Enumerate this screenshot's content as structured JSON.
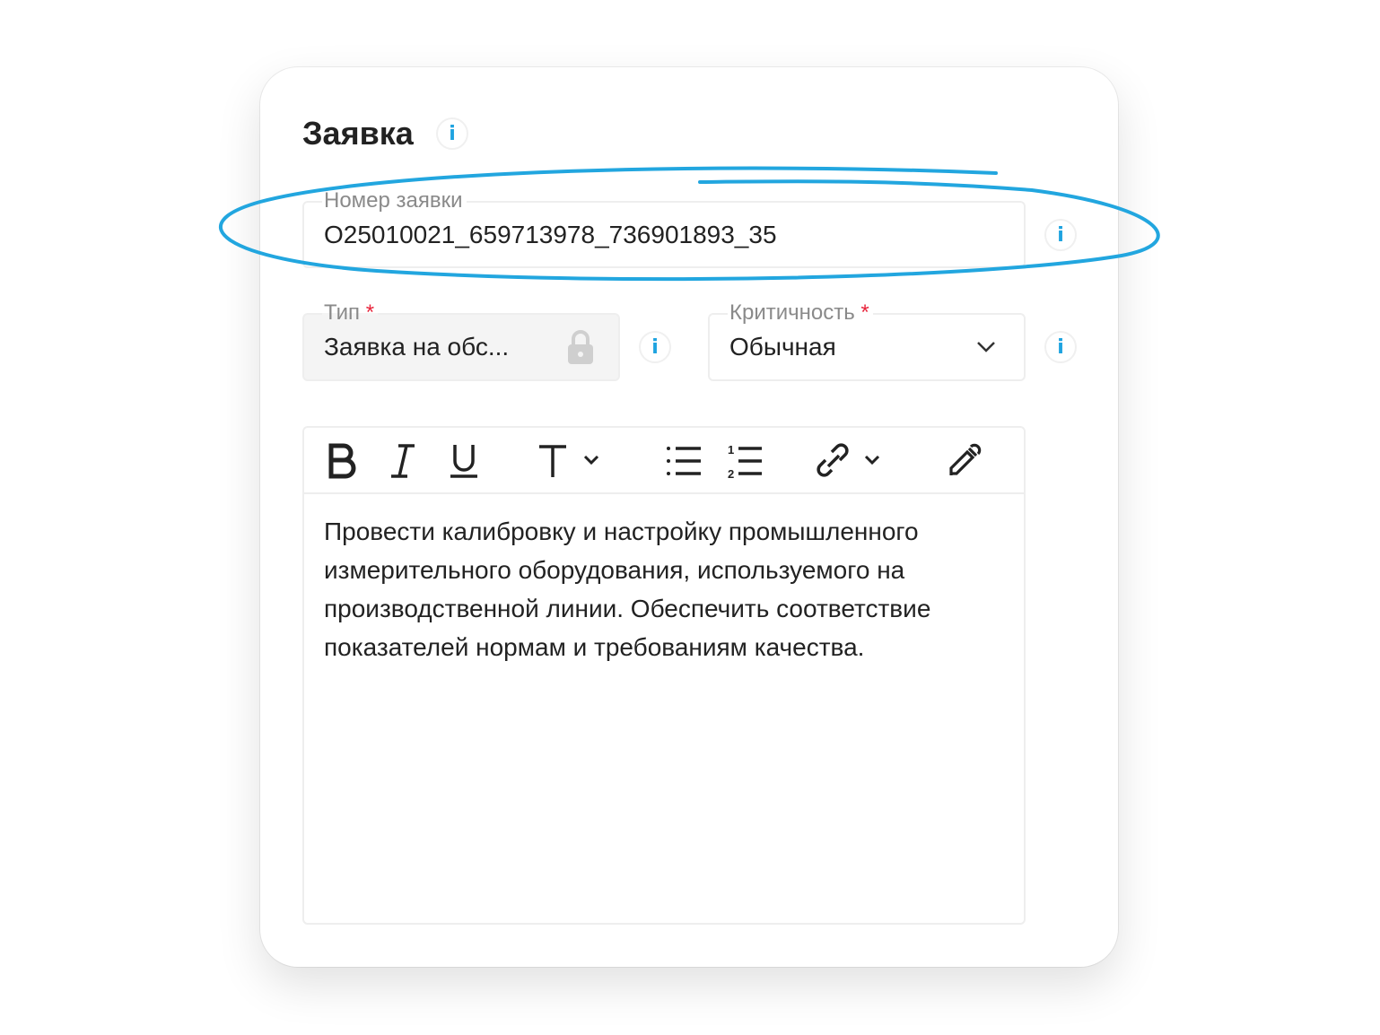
{
  "card": {
    "title": "Заявка",
    "info_glyph": "i",
    "request_number": {
      "label": "Номер заявки",
      "value": "O25010021_659713978_736901893_35"
    },
    "type": {
      "label": "Тип",
      "required": "*",
      "value": "Заявка на обс...",
      "locked": true
    },
    "criticality": {
      "label": "Критичность",
      "required": "*",
      "value": "Обычная"
    },
    "editor": {
      "toolbar": [
        "bold",
        "italic",
        "underline",
        "text-style",
        "bullet-list",
        "numbered-list",
        "link",
        "eyedropper"
      ],
      "text": "Провести калибровку и настройку промышленного измерительного оборудования, используемого на производственной линии. Обеспечить соответствие показателей нормам и требованиям качества."
    }
  },
  "colors": {
    "accent": "#1ea3e0",
    "required": "#e8243b",
    "annotation": "#22a6df"
  }
}
